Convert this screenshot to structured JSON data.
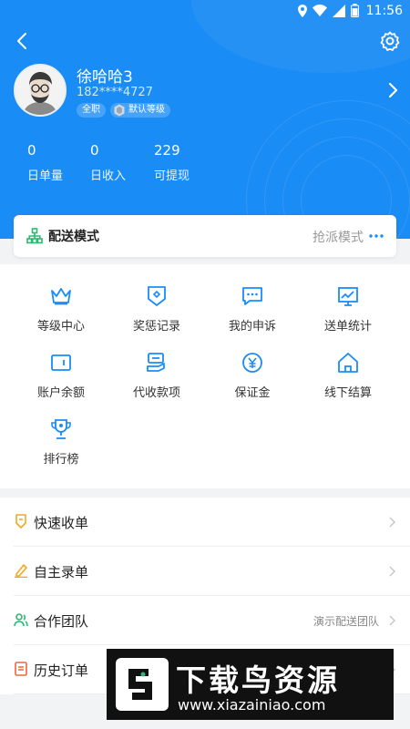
{
  "status_bar": {
    "time": "11:56"
  },
  "profile": {
    "name": "徐哈哈3",
    "phone": "182****4727",
    "badge_type": "全职",
    "badge_level": "默认等级"
  },
  "stats": [
    {
      "value": "0",
      "label": "日单量"
    },
    {
      "value": "0",
      "label": "日收入"
    },
    {
      "value": "229",
      "label": "可提现"
    }
  ],
  "delivery_mode": {
    "title": "配送模式",
    "value": "抢派模式"
  },
  "grid": [
    {
      "label": "等级中心",
      "icon": "crown-icon"
    },
    {
      "label": "奖惩记录",
      "icon": "shield-icon"
    },
    {
      "label": "我的申诉",
      "icon": "message-icon"
    },
    {
      "label": "送单统计",
      "icon": "chart-icon"
    },
    {
      "label": "账户余额",
      "icon": "wallet-icon"
    },
    {
      "label": "代收款项",
      "icon": "payment-icon"
    },
    {
      "label": "保证金",
      "icon": "yen-coin-icon"
    },
    {
      "label": "线下结算",
      "icon": "house-icon"
    },
    {
      "label": "排行榜",
      "icon": "trophy-icon"
    }
  ],
  "list": [
    {
      "label": "快速收单",
      "value": "",
      "icon": "quick-order-icon"
    },
    {
      "label": "自主录单",
      "value": "",
      "icon": "pen-icon"
    },
    {
      "label": "合作团队",
      "value": "演示配送团队",
      "icon": "team-icon"
    },
    {
      "label": "历史订单",
      "value": "",
      "icon": "history-icon"
    }
  ],
  "watermark": {
    "title": "下载鸟资源",
    "url": "www.xiazainiao.com"
  },
  "colors": {
    "primary": "#1a8cf5",
    "green": "#2eb872",
    "orange": "#f5a623"
  }
}
